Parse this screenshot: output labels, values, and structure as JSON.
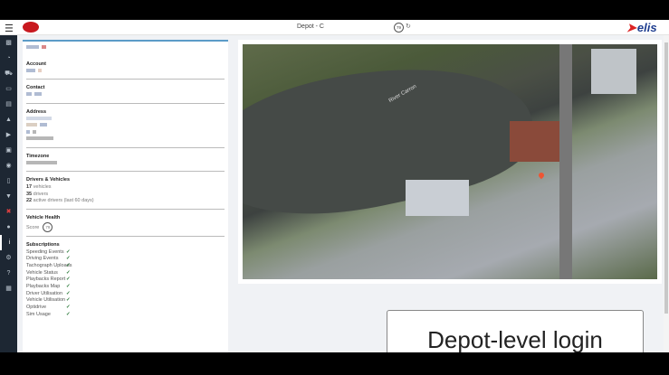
{
  "header": {
    "title": "Depot - C",
    "score": "79",
    "brand": "elis"
  },
  "sidebar": [
    "chart",
    "dashboard",
    "car",
    "card",
    "bus",
    "alert",
    "play",
    "monitor",
    "eye",
    "mobile",
    "trophy",
    "tools",
    "user",
    "info",
    "gear",
    "help",
    "image"
  ],
  "panel": {
    "account": "Account",
    "contact": "Contact",
    "address": "Address",
    "timezone": "Timezone",
    "drivers_title": "Drivers & Vehicles",
    "vehicles_n": "17",
    "vehicles_l": "vehicles",
    "drivers_n": "35",
    "drivers_l": "drivers",
    "active_n": "22",
    "active_l": "active drivers (last 60 days)",
    "health_title": "Vehicle Health",
    "score_label": "Score",
    "score": "79",
    "subs_title": "Subscriptions",
    "subs": [
      "Speeding Events",
      "Driving Events",
      "Tachograph Uploads",
      "Vehicle Status",
      "Playbacks Report",
      "Playbacks Map",
      "Driver Utilisation",
      "Vehicle Utilisation",
      "Optidrive",
      "Sim Usage"
    ]
  },
  "map": {
    "river_label": "River Carron"
  },
  "caption": "Depot-level login"
}
